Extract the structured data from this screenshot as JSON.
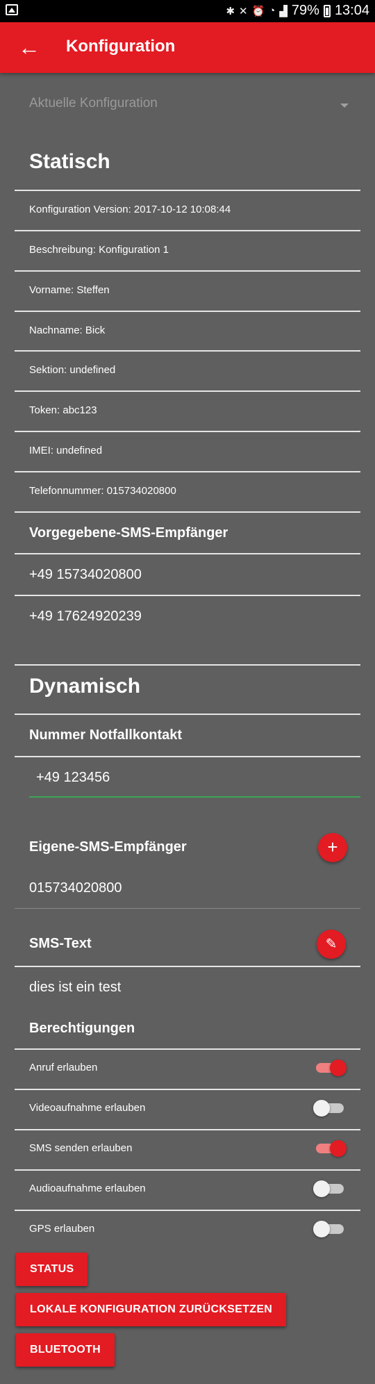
{
  "statusbar": {
    "battery": "79%",
    "time": "13:04"
  },
  "appbar": {
    "title": "Konfiguration"
  },
  "config_select": {
    "value": "Aktuelle Konfiguration"
  },
  "static": {
    "title": "Statisch",
    "rows": [
      "Konfiguration Version: 2017-10-12 10:08:44",
      "Beschreibung: Konfiguration 1",
      "Vorname: Steffen",
      "Nachname: Bick",
      "Sektion: undefined",
      "Token: abc123",
      "IMEI: undefined",
      "Telefonnummer: 015734020800"
    ],
    "sms_recipients_title": "Vorgegebene-SMS-Empfänger",
    "sms_recipients": [
      "+49 15734020800",
      "+49 17624920239"
    ]
  },
  "dynamic": {
    "title": "Dynamisch",
    "emergency_title": "Nummer Notfallkontakt",
    "emergency_value": "+49 123456",
    "own_sms_title": "Eigene-SMS-Empfänger",
    "own_sms_recipient": "015734020800",
    "sms_text_title": "SMS-Text",
    "sms_text": "dies ist ein test"
  },
  "permissions": {
    "title": "Berechtigungen",
    "items": [
      {
        "label": "Anruf erlauben",
        "on": true
      },
      {
        "label": "Videoaufnahme erlauben",
        "on": false
      },
      {
        "label": "SMS senden erlauben",
        "on": true
      },
      {
        "label": "Audioaufnahme erlauben",
        "on": false
      },
      {
        "label": "GPS erlauben",
        "on": false
      }
    ]
  },
  "buttons": {
    "status": "STATUS",
    "reset": "LOKALE KONFIGURATION ZURÜCKSETZEN",
    "bluetooth": "BLUETOOTH"
  },
  "colors": {
    "accent": "#e31b23",
    "background": "#5f5f5f",
    "input_underline": "#3aa657"
  }
}
